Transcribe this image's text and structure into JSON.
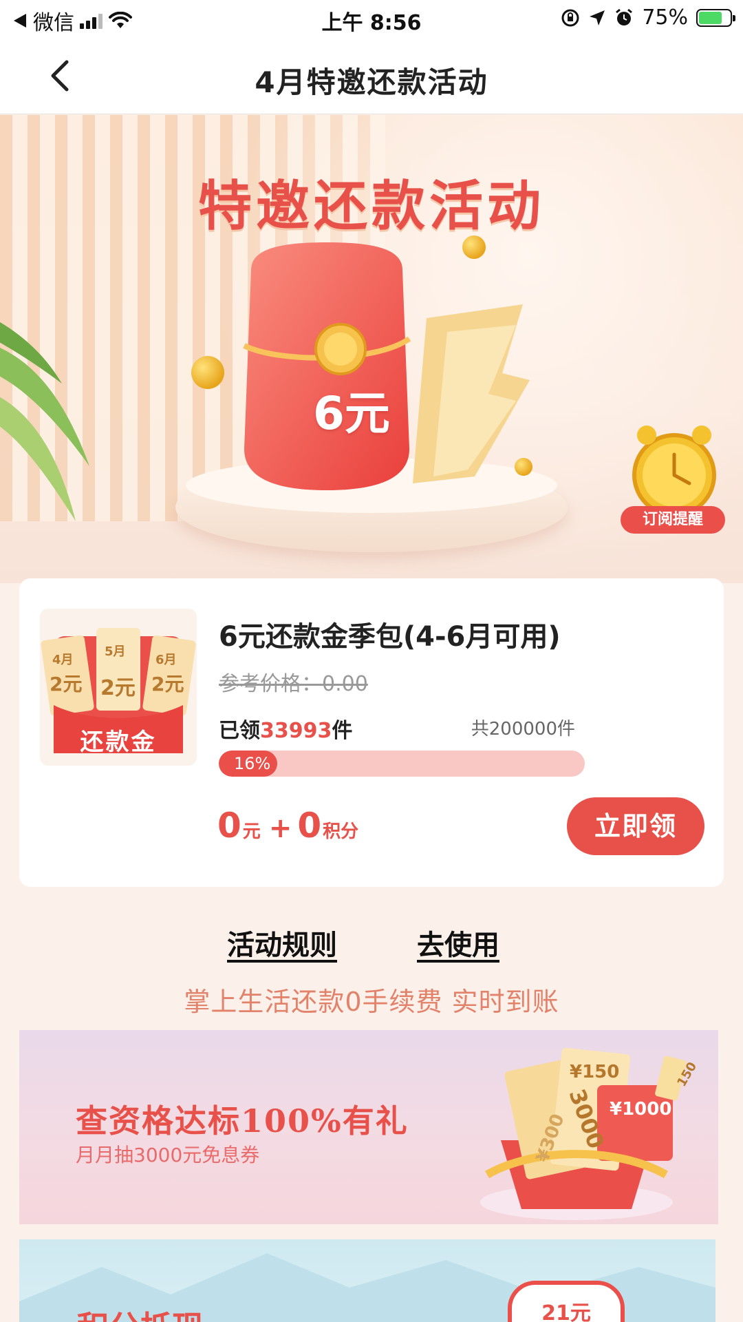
{
  "status_bar": {
    "carrier": "微信",
    "time": "上午 8:56",
    "battery_percent": "75%",
    "battery_level": 0.75
  },
  "nav": {
    "title": "4月特邀还款活动"
  },
  "hero": {
    "title": "特邀还款活动",
    "envelope_amount": "6元",
    "subscribe_label": "订阅提醒"
  },
  "product": {
    "thumb_tickets": [
      "4月",
      "5月",
      "6月"
    ],
    "thumb_values": [
      "2元",
      "2元",
      "2元"
    ],
    "thumb_label": "还款金",
    "title": "6元还款金季包(4-6月可用)",
    "ref_price": "参考价格：0.00",
    "claimed_prefix": "已领",
    "claimed_count": "33993",
    "claimed_suffix": "件",
    "total": "共200000件",
    "progress_text": "16%",
    "progress_value": 0.16,
    "price_cash": "0",
    "price_cash_unit": "元",
    "price_plus": "+",
    "price_points": "0",
    "price_points_unit": "积分",
    "claim_label": "立即领"
  },
  "links": {
    "rules": "活动规则",
    "use": "去使用"
  },
  "tagline": "掌上生活还款0手续费 实时到账",
  "banner1": {
    "title": "查资格达标100%有礼",
    "subtitle": "月月抽3000元免息券",
    "coupon_values": [
      "¥150",
      "3000",
      "¥1000",
      "¥300",
      "150"
    ]
  },
  "banner2": {
    "title": "积分抵现",
    "badge": "21元"
  },
  "colors": {
    "accent": "#e8504a",
    "background": "#fbf0ea",
    "progress_track": "#f9c7c4"
  }
}
